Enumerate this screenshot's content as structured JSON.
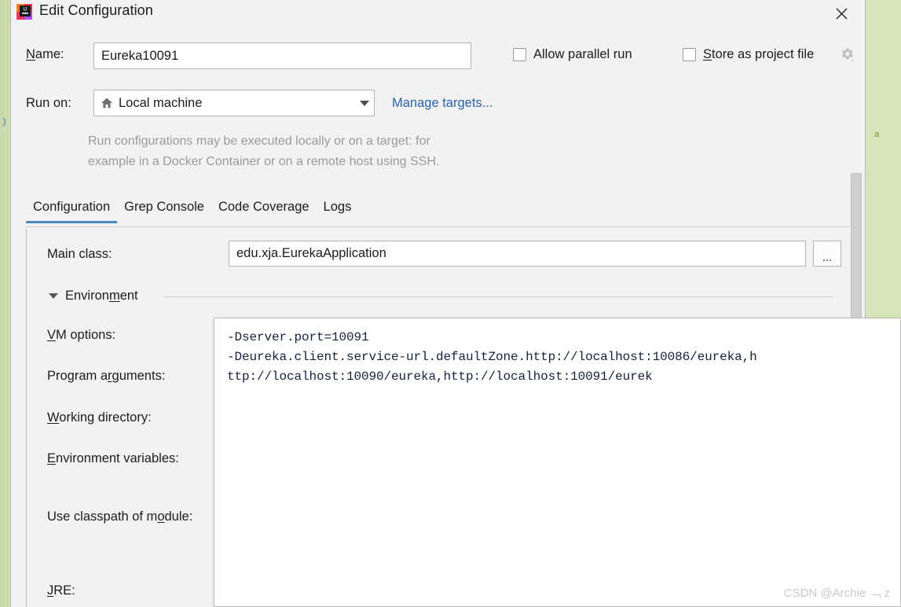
{
  "window": {
    "title": "Edit Configuration",
    "app_icon": "intellij-idea-icon",
    "close_label": "✕"
  },
  "form": {
    "name_label": "Name:",
    "name_label_mnemonic": "N",
    "name_value": "Eureka10091",
    "run_on_label": "Run on:",
    "run_on_value": "Local machine",
    "run_on_icon": "home-icon",
    "manage_targets_link": "Manage targets...",
    "hint": "Run configurations may be executed locally or on a target: for\nexample in a Docker Container or on a remote host using SSH.",
    "allow_parallel_run_label": "Allow parallel run",
    "allow_parallel_run_mnemonic": "u",
    "allow_parallel_run_checked": false,
    "store_as_project_file_label": "Store as project file",
    "store_as_project_file_mnemonic": "S",
    "store_as_project_file_checked": false,
    "gear_icon": "gear-dropdown-icon"
  },
  "tabs": [
    {
      "label": "Configuration",
      "active": true
    },
    {
      "label": "Grep Console",
      "active": false
    },
    {
      "label": "Code Coverage",
      "active": false
    },
    {
      "label": "Logs",
      "active": false
    }
  ],
  "configuration": {
    "main_class_label": "Main class:",
    "main_class_value": "edu.xja.EurekaApplication",
    "browse_button_label": "...",
    "environment_section_label": "Environment",
    "environment_section_mnemonic": "m",
    "fields": [
      {
        "label": "VM options:",
        "mnemonic": "V"
      },
      {
        "label": "Program arguments:",
        "mnemonic": "r"
      },
      {
        "label": "Working directory:",
        "mnemonic": "W"
      },
      {
        "label": "Environment variables:",
        "mnemonic": "E"
      },
      {
        "label": "Use classpath of module:",
        "mnemonic": "o"
      },
      {
        "label": "JRE:",
        "mnemonic": "J"
      }
    ]
  },
  "vm_options_editor": {
    "content": "-Dserver.port=10091\n-Deureka.client.service-url.defaultZone.http://localhost:10086/eureka,h\nttp://localhost:10090/eureka,http://localhost:10091/eurek"
  },
  "watermark": "CSDN @Archie ﹁ z",
  "colors": {
    "dialog_bg": "#f2f2f2",
    "accent_blue": "#4a88c7",
    "link_blue": "#2862a8",
    "ide_editor_green": "#d6e5b7",
    "text": "#1c1c1c",
    "hint_gray": "#9a9a9a",
    "code_text": "#14223d"
  }
}
